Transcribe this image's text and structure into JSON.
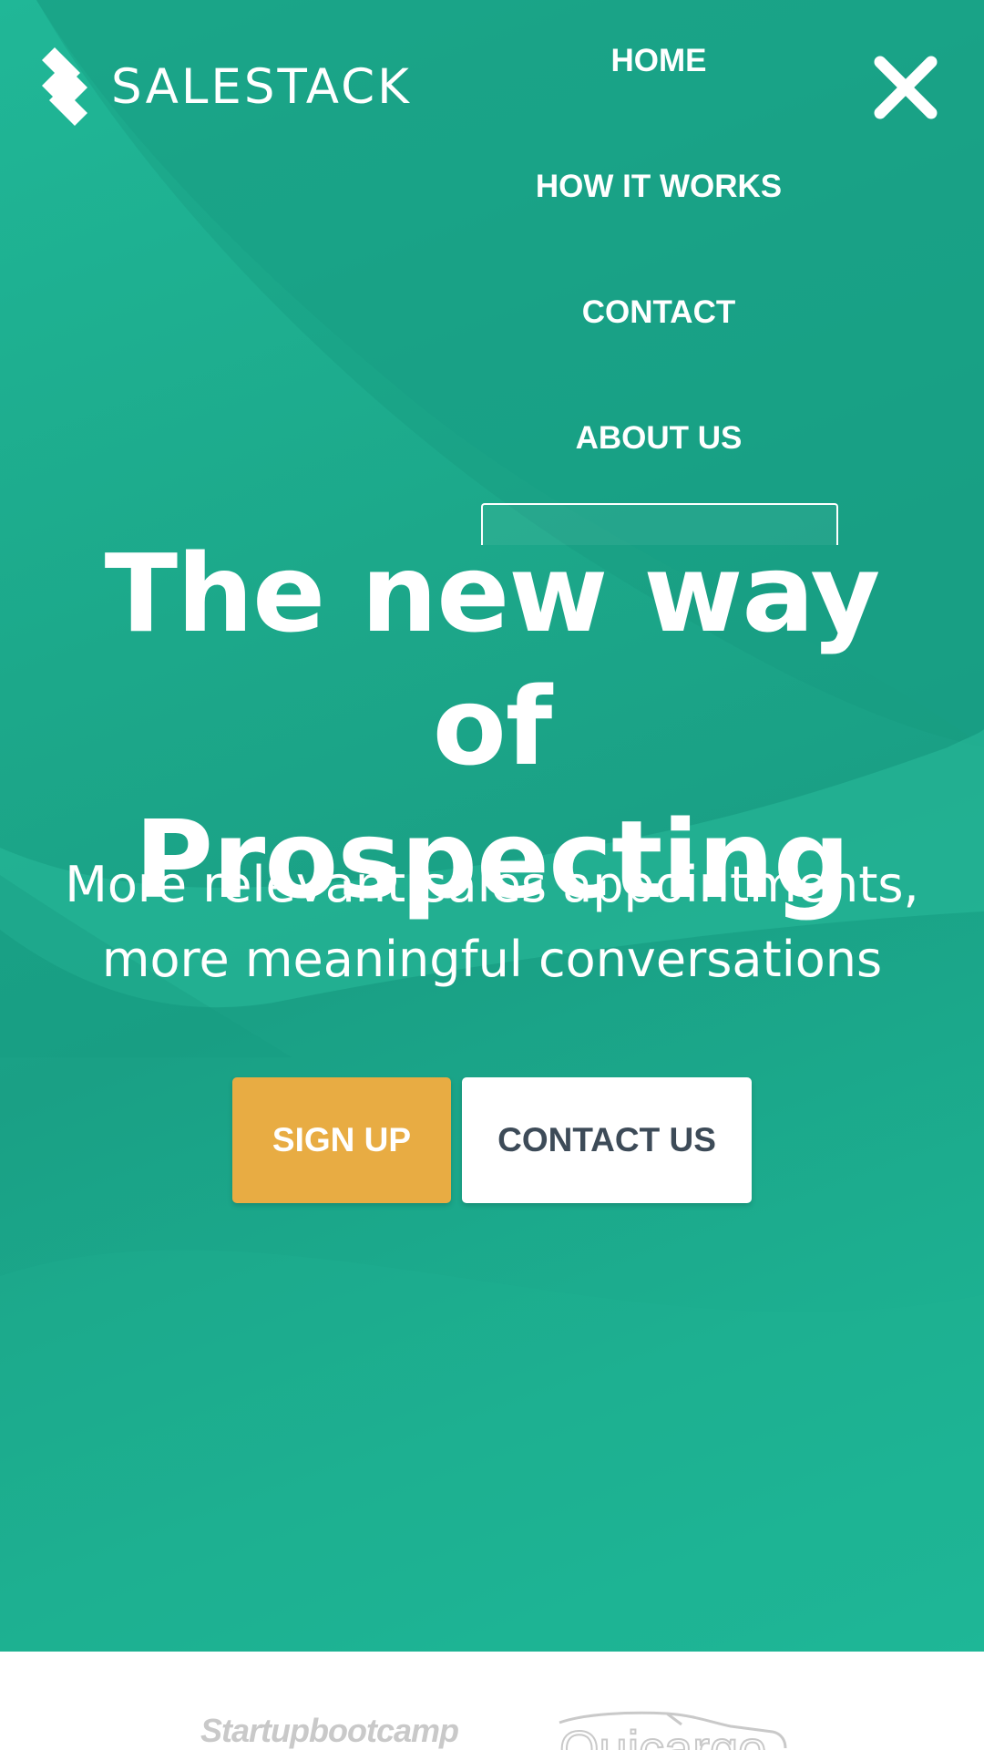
{
  "brand": {
    "name": "SALESTACK"
  },
  "nav": {
    "items": [
      {
        "label": "HOME"
      },
      {
        "label": "HOW IT WORKS"
      },
      {
        "label": "CONTACT"
      },
      {
        "label": "ABOUT US"
      }
    ]
  },
  "hero": {
    "headline_line1": "The new way of",
    "headline_line2": "Prospecting",
    "subheadline_line1": "More relevant sales appointments,",
    "subheadline_line2": "more meaningful conversations",
    "signup_label": "SIGN UP",
    "contact_label": "CONTACT US"
  },
  "partners": {
    "startupbootcamp": "Startupbootcamp",
    "quicargo": "Quicargo"
  },
  "icons": {
    "close": "close-icon",
    "logo": "salestack-logo-icon"
  },
  "colors": {
    "hero_green": "#1ca88a",
    "signup_orange": "#e8ac43",
    "contact_text": "#3d4b58",
    "white": "#ffffff"
  }
}
